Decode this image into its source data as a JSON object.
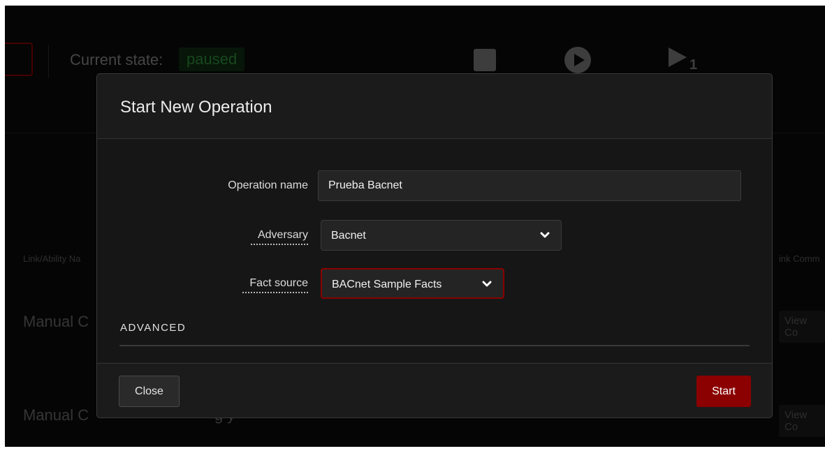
{
  "background": {
    "current_state_label": "Current state:",
    "current_state_value": "paused",
    "icons": [
      "stop-icon",
      "play-icon",
      "step-icon"
    ],
    "step_count": "1",
    "column_left": "Link/Ability Na",
    "column_right": "ink Comm",
    "rows": [
      {
        "left": "Manual C",
        "mid": "",
        "right": "View Co"
      },
      {
        "left": "Manual C",
        "mid": "g y",
        "right": "View Co"
      }
    ]
  },
  "modal": {
    "title": "Start New Operation",
    "fields": {
      "operation_name_label": "Operation name",
      "operation_name_value": "Prueba Bacnet",
      "adversary_label": "Adversary",
      "adversary_value": "Bacnet",
      "fact_source_label": "Fact source",
      "fact_source_value": "BACnet Sample Facts"
    },
    "advanced_label": "ADVANCED",
    "buttons": {
      "close": "Close",
      "start": "Start"
    }
  },
  "colors": {
    "accent": "#8b0000",
    "modal_bg": "#1b1b1b",
    "body_bg": "#161616",
    "page_bg": "#0b0b0b",
    "status_green": "#2f8f3a"
  }
}
